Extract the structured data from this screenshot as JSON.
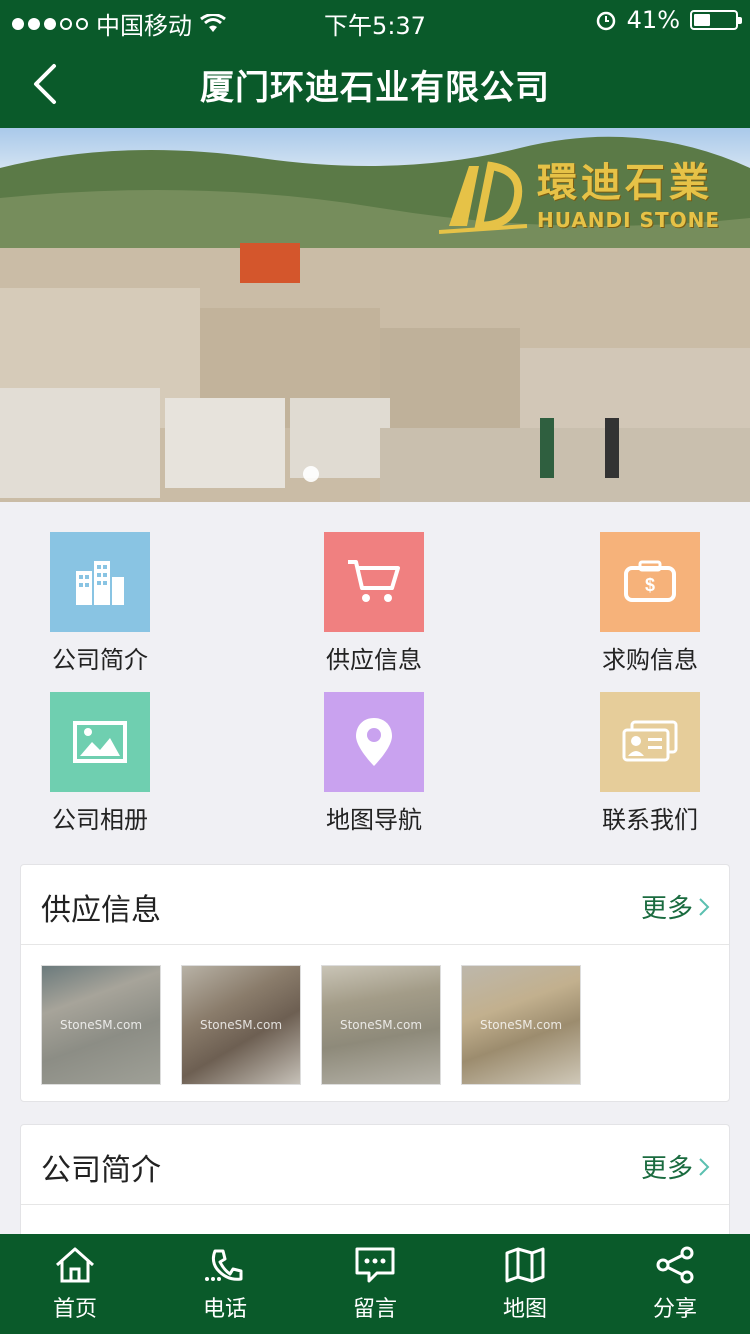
{
  "status_bar": {
    "carrier": "中国移动",
    "time": "下午5:37",
    "battery": "41%",
    "battery_level": 0.41
  },
  "header": {
    "title": "厦门环迪石业有限公司"
  },
  "banner": {
    "logo_cn": "環迪石業",
    "logo_en": "HUANDI STONE"
  },
  "quick_links": [
    {
      "label": "公司简介",
      "icon": "building-icon",
      "color": "#89c4e3"
    },
    {
      "label": "供应信息",
      "icon": "cart-icon",
      "color": "#f08080"
    },
    {
      "label": "求购信息",
      "icon": "wallet-icon",
      "color": "#f6b27a"
    },
    {
      "label": "公司相册",
      "icon": "photo-icon",
      "color": "#6fcfb0"
    },
    {
      "label": "地图导航",
      "icon": "location-pin-icon",
      "color": "#c9a2ef"
    },
    {
      "label": "联系我们",
      "icon": "contact-card-icon",
      "color": "#e6cd9a"
    }
  ],
  "supply_section": {
    "title": "供应信息",
    "more": "更多",
    "thumbnails": [
      {
        "watermark": "StoneSM.com"
      },
      {
        "watermark": "StoneSM.com"
      },
      {
        "watermark": "StoneSM.com"
      },
      {
        "watermark": "StoneSM.com"
      }
    ]
  },
  "company_section": {
    "title": "公司简介",
    "more": "更多"
  },
  "tabbar": [
    {
      "label": "首页",
      "icon": "home-icon"
    },
    {
      "label": "电话",
      "icon": "phone-icon"
    },
    {
      "label": "留言",
      "icon": "message-icon"
    },
    {
      "label": "地图",
      "icon": "map-icon"
    },
    {
      "label": "分享",
      "icon": "share-icon"
    }
  ],
  "colors": {
    "brand_green": "#0a5a2a",
    "more_link": "#1a6b3f"
  }
}
